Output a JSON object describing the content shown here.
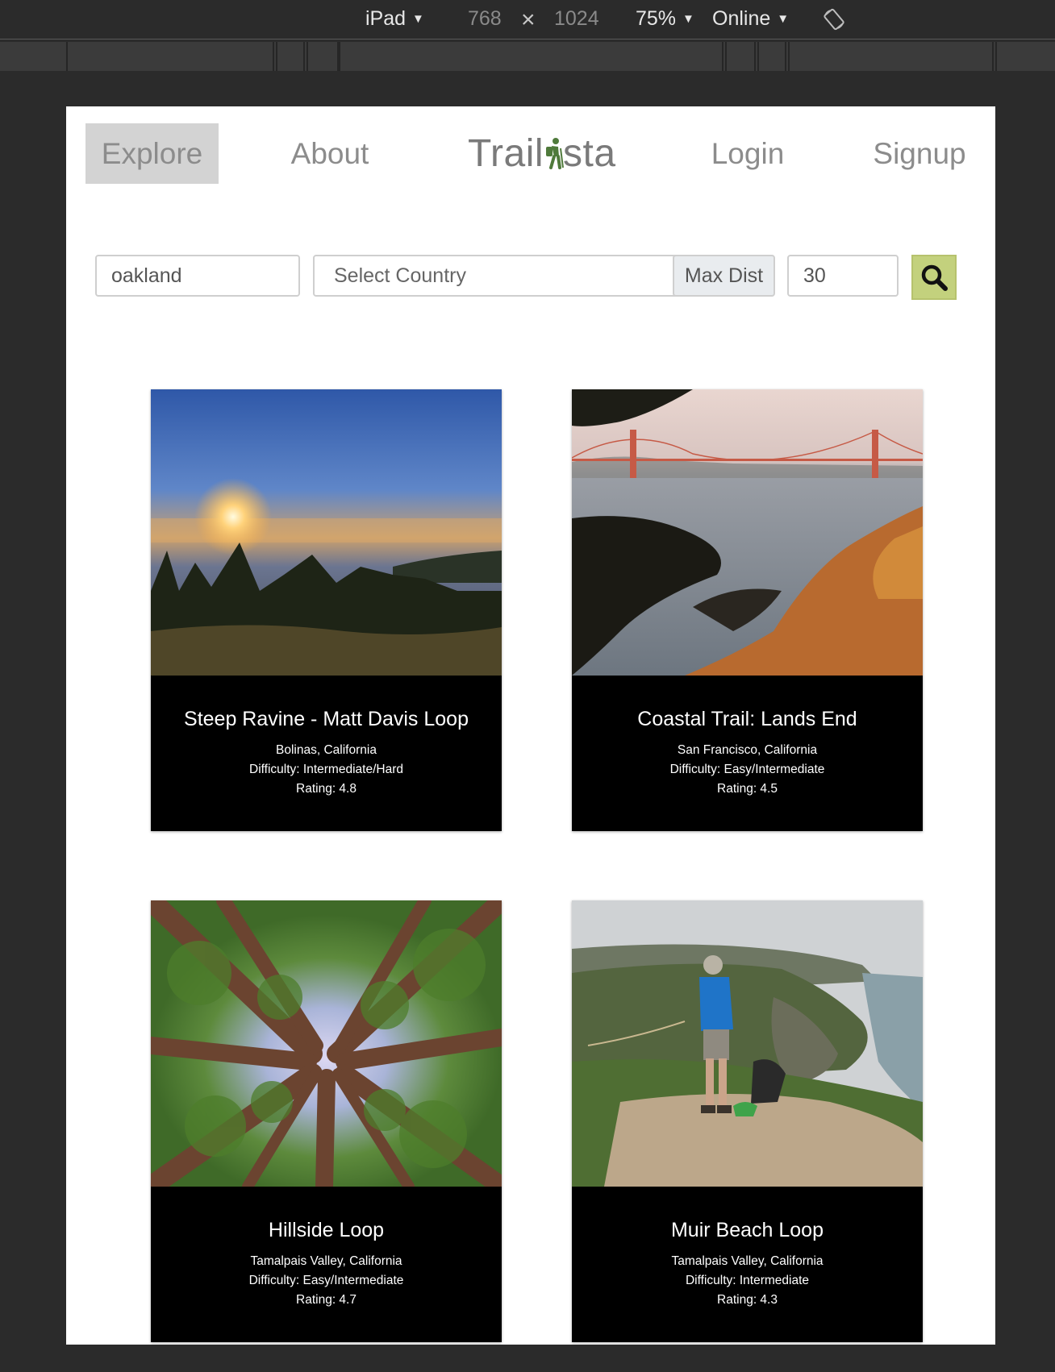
{
  "devtools": {
    "device": "iPad",
    "width": "768",
    "times": "×",
    "height": "1024",
    "zoom": "75%",
    "network": "Online",
    "dropdown_glyph": "▼",
    "rotate_icon": "rotate-icon"
  },
  "nav": {
    "explore": "Explore",
    "about": "About",
    "brand_prefix": "Trail",
    "brand_suffix": "sta",
    "brand_icon": "hiker-icon",
    "login": "Login",
    "signup": "Signup"
  },
  "search": {
    "location_value": "oakland",
    "country_placeholder": "Select Country",
    "max_dist_label": "Max Dist",
    "max_dist_value": "30",
    "button_icon": "search-icon",
    "button_color": "#c3d17d"
  },
  "trails": [
    {
      "name": "Steep Ravine - Matt Davis Loop",
      "location": "Bolinas, California",
      "difficulty": "Difficulty: Intermediate/Hard",
      "rating": "Rating: 4.8",
      "image": "sunset over forested ridge and ocean"
    },
    {
      "name": "Coastal Trail: Lands End",
      "location": "San Francisco, California",
      "difficulty": "Difficulty: Easy/Intermediate",
      "rating": "Rating: 4.5",
      "image": "Golden Gate Bridge from rocky coast"
    },
    {
      "name": "Hillside Loop",
      "location": "Tamalpais Valley, California",
      "difficulty": "Difficulty: Easy/Intermediate",
      "rating": "Rating: 4.7",
      "image": "redwood canopy looking up"
    },
    {
      "name": "Muir Beach Loop",
      "location": "Tamalpais Valley, California",
      "difficulty": "Difficulty: Intermediate",
      "rating": "Rating: 4.3",
      "image": "hiker on coastal cliff overlook"
    }
  ],
  "colors": {
    "devtools_bg": "#2b2b2b",
    "nav_active_bg": "#d3d3d3",
    "card_body_bg": "#000000"
  }
}
